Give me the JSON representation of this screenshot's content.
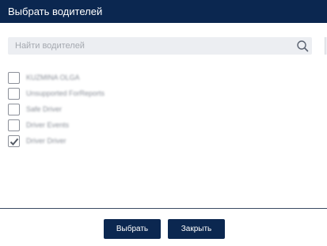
{
  "dialog": {
    "title": "Выбрать водителей"
  },
  "search": {
    "placeholder": "Найти водителей",
    "value": ""
  },
  "drivers": [
    {
      "label": "KUZMINA OLGA",
      "checked": false
    },
    {
      "label": "Unsupported ForReports",
      "checked": false
    },
    {
      "label": "Safe Driver",
      "checked": false
    },
    {
      "label": "Driver Events",
      "checked": false
    },
    {
      "label": "Driver Driver",
      "checked": true
    }
  ],
  "footer": {
    "select_label": "Выбрать",
    "close_label": "Закрыть"
  },
  "colors": {
    "header_bg": "#0b2750",
    "button_bg": "#0b2750",
    "search_bg": "#eceef2"
  }
}
